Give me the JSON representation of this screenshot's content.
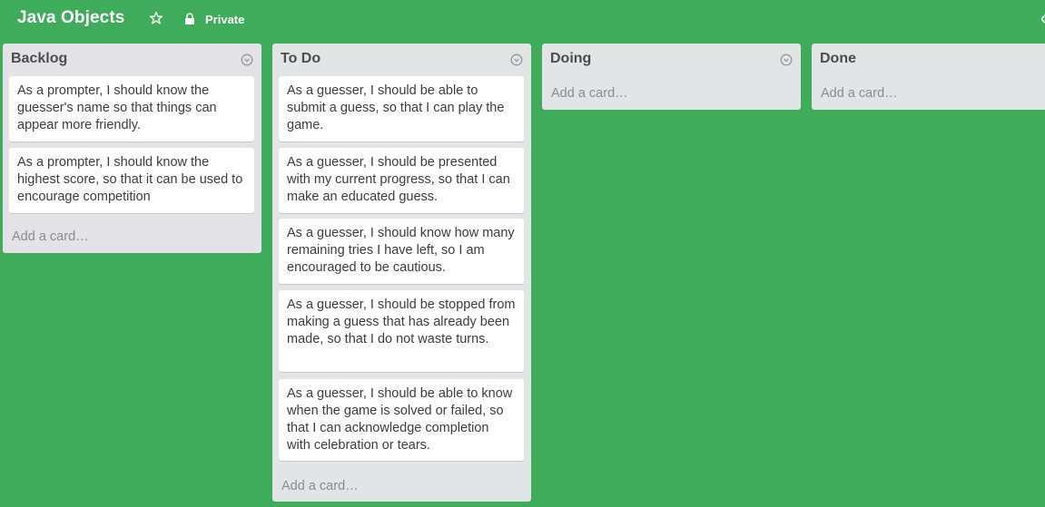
{
  "board": {
    "title": "Java Objects",
    "visibility": "Private",
    "background_color": "#3fac5b"
  },
  "icons": {
    "star": "star-outline-icon",
    "lock": "lock-icon",
    "list_menu": "circle-chevron-down-icon"
  },
  "lists": [
    {
      "title": "Backlog",
      "cards": [
        "As a prompter, I should know the guesser's name so that things can appear more friendly.",
        "As a prompter, I should know the highest score, so that it can be used to encourage competition"
      ],
      "add_card": "Add a card…"
    },
    {
      "title": "To Do",
      "cards": [
        "As a guesser, I should be able to submit a guess, so that I can play the game.",
        "As a guesser, I should be presented with my current progress, so that I can make an educated guess.",
        "As a guesser, I should know how many remaining tries I have left, so I am encouraged to be cautious.",
        "As a guesser, I should be stopped from making a guess that has already been made, so that I do not waste turns.",
        "As a guesser, I should be able to know when the game is solved or failed, so that I can acknowledge completion with celebration or tears."
      ],
      "add_card": "Add a card…"
    },
    {
      "title": "Doing",
      "cards": [],
      "add_card": "Add a card…"
    },
    {
      "title": "Done",
      "cards": [],
      "add_card": "Add a card…"
    }
  ]
}
